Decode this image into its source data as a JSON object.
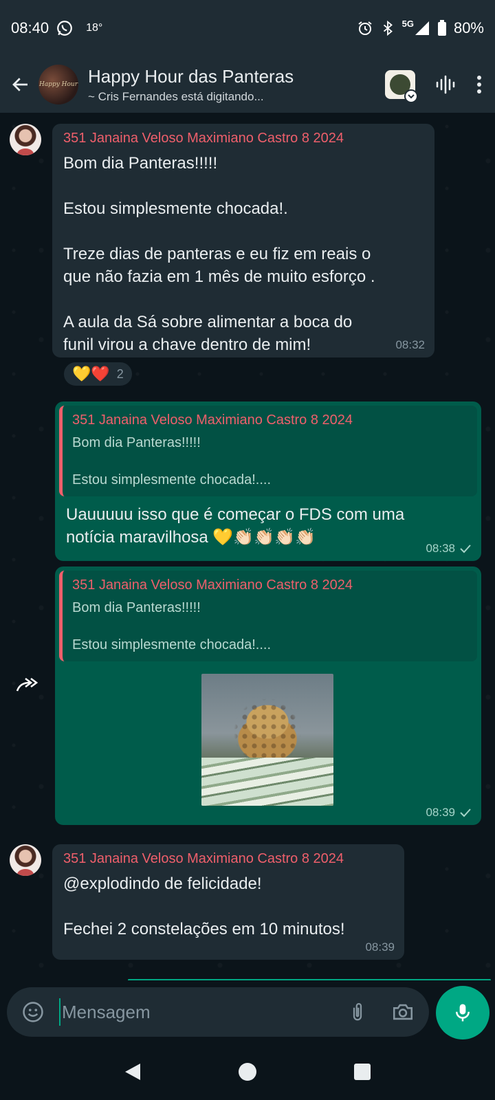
{
  "status_bar": {
    "time": "08:40",
    "temperature": "18°",
    "network": "5G",
    "battery": "80%"
  },
  "header": {
    "group_avatar_text": "Happy Hour",
    "title": "Happy Hour das Panteras",
    "subtitle": "~ Cris Fernandes está digitando..."
  },
  "messages": [
    {
      "sender": "351 Janaina Veloso Maximiano Castro 8 2024",
      "text": "Bom dia Panteras!!!!!\n\nEstou simplesmente chocada!.\n\nTreze dias de panteras e eu fiz em reais o\nque não fazia em 1 mês de muito esforço .\n\nA aula da Sá sobre alimentar a boca do\nfunil virou a chave dentro de mim!",
      "time": "08:32",
      "reactions": "💛❤️",
      "reaction_count": "2"
    },
    {
      "quote_sender": "351 Janaina Veloso Maximiano Castro 8 2024",
      "quote_text": "Bom dia Panteras!!!!!\n\nEstou simplesmente chocada!....",
      "text": "Uauuuuu isso que é começar o FDS com uma\nnotícia maravilhosa 💛👏🏻👏🏻👏🏻👏🏻",
      "time": "08:38"
    },
    {
      "quote_sender": "351 Janaina Veloso Maximiano Castro 8 2024",
      "quote_text": "Bom dia Panteras!!!!!\n\nEstou simplesmente chocada!....",
      "time": "08:39"
    },
    {
      "sender": "351 Janaina Veloso Maximiano Castro 8 2024",
      "text": "@explodindo de felicidade!\n\nFechei 2 constelações em 10 minutos!",
      "time": "08:39"
    }
  ],
  "composer": {
    "placeholder": "Mensagem"
  },
  "colors": {
    "accent": "#00a884",
    "sender_name": "#ef5f6b",
    "outgoing_bubble": "#005c4b",
    "incoming_bubble": "#1f2c34"
  }
}
